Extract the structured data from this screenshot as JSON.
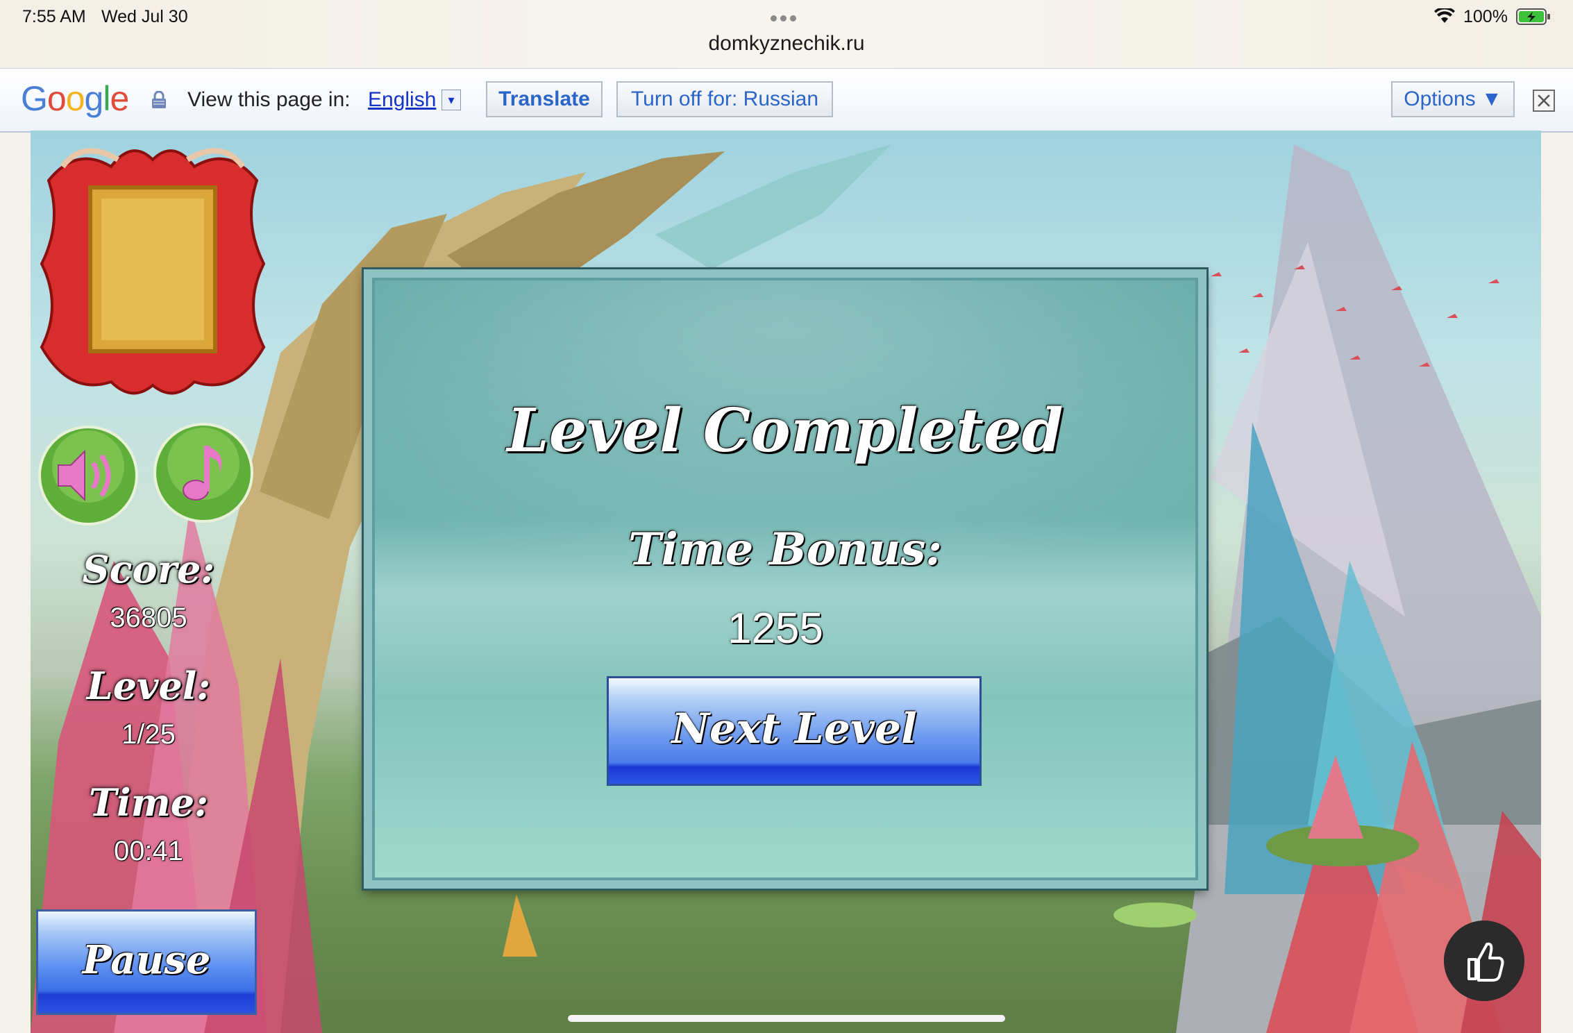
{
  "status_bar": {
    "time": "7:55 AM",
    "date": "Wed Jul 30",
    "url": "domkyznechik.ru",
    "battery": "100%"
  },
  "translate_bar": {
    "logo": [
      "G",
      "o",
      "o",
      "g",
      "l",
      "e"
    ],
    "view_label": "View this page in:",
    "language": "English",
    "dropdown_glyph": "▾",
    "translate_label": "Translate",
    "turn_off_label": "Turn off for: Russian",
    "options_label": "Options ▼"
  },
  "hud": {
    "score_label": "Score:",
    "score": "36805",
    "level_label": "Level:",
    "level": "1/25",
    "time_label": "Time:",
    "time": "00:41",
    "pause_label": "Pause"
  },
  "dialog": {
    "title": "Level Completed",
    "bonus_label": "Time Bonus:",
    "bonus_value": "1255",
    "next_label": "Next Level"
  },
  "colors": {
    "accent_blue": "#3b6fe6",
    "dialog_teal": "#6fb3b0",
    "link_blue": "#1533c4"
  }
}
